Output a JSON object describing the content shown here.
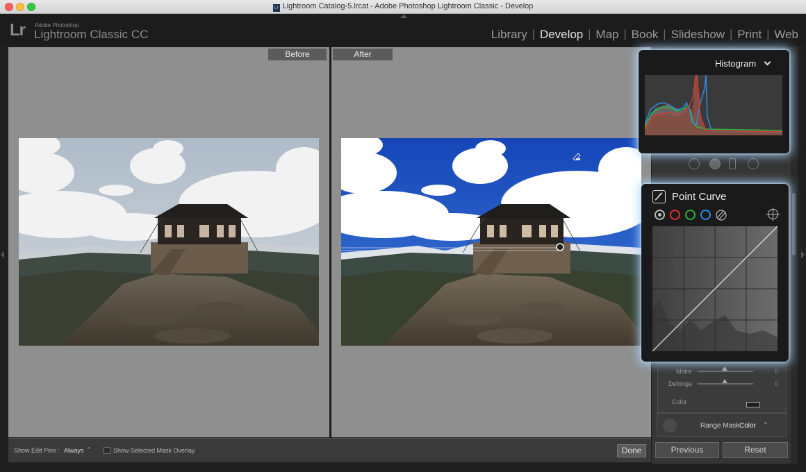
{
  "window": {
    "title": "Lightroom Catalog-5.lrcat - Adobe Photoshop Lightroom Classic - Develop",
    "doc_icon": "Lr"
  },
  "brand": {
    "logo": "Lr",
    "small": "Adobe Photoshop",
    "big": "Lightroom Classic CC"
  },
  "modules": {
    "items": [
      "Library",
      "Develop",
      "Map",
      "Book",
      "Slideshow",
      "Print",
      "Web"
    ],
    "active": "Develop"
  },
  "viewer": {
    "before_label": "Before",
    "after_label": "After"
  },
  "toolbar": {
    "edit_pins_label": "Show Edit Pins :",
    "edit_pins_value": "Always",
    "edit_pins_arrow": "⌃",
    "mask_overlay_label": "Show Selected Mask Overlay",
    "done_label": "Done"
  },
  "histogram": {
    "title": "Histogram"
  },
  "point_curve": {
    "title": "Point Curve",
    "channels": [
      "rgb",
      "red",
      "green",
      "blue"
    ],
    "channel_colors": {
      "rgb": "#bdbdbd",
      "red": "#e0332f",
      "green": "#2fb33d",
      "blue": "#2f8be0"
    }
  },
  "panel": {
    "moire_label": "Moire",
    "moire_value": "0",
    "defringe_label": "Defringe",
    "defringe_value": "0",
    "color_label": "Color",
    "range_mask_label": "Range Mask :",
    "range_mask_value": "Color",
    "range_mask_arrow": "⌃",
    "previous_label": "Previous",
    "reset_label": "Reset"
  }
}
